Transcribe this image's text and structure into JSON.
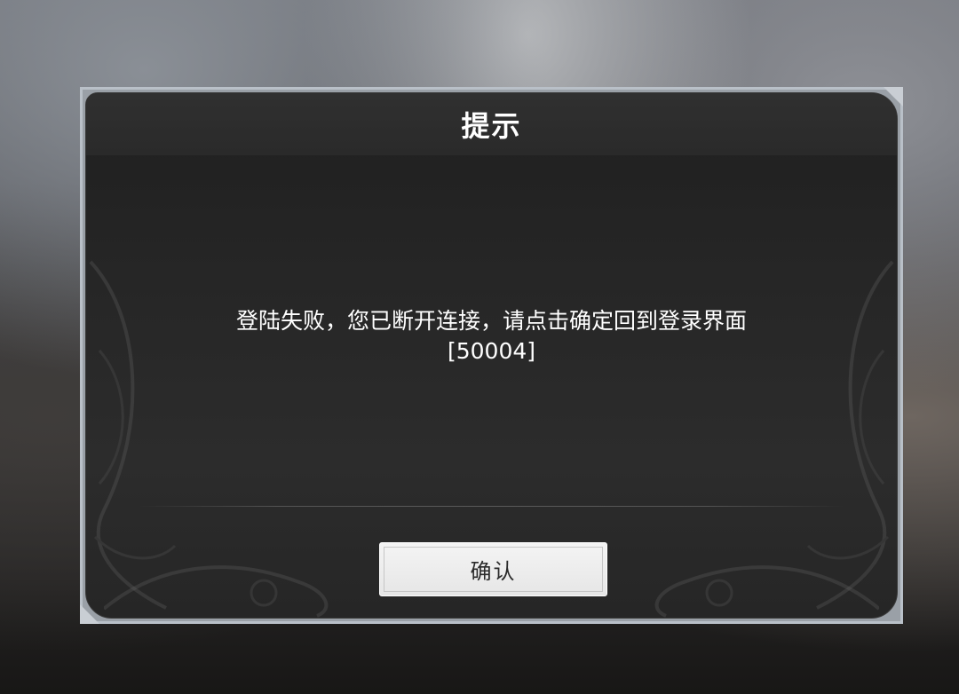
{
  "dialog": {
    "title": "提示",
    "message_line_1": "登陆失败，您已断开连接，请点击确定回到登录界面",
    "message_line_2": "[50004]",
    "confirm_label": "确认"
  },
  "colors": {
    "dialog_background": "#262626",
    "dialog_border": "#b9c0c8",
    "title_text": "#ffffff",
    "button_background": "#eeeeee",
    "button_text": "#2a2a2a"
  }
}
